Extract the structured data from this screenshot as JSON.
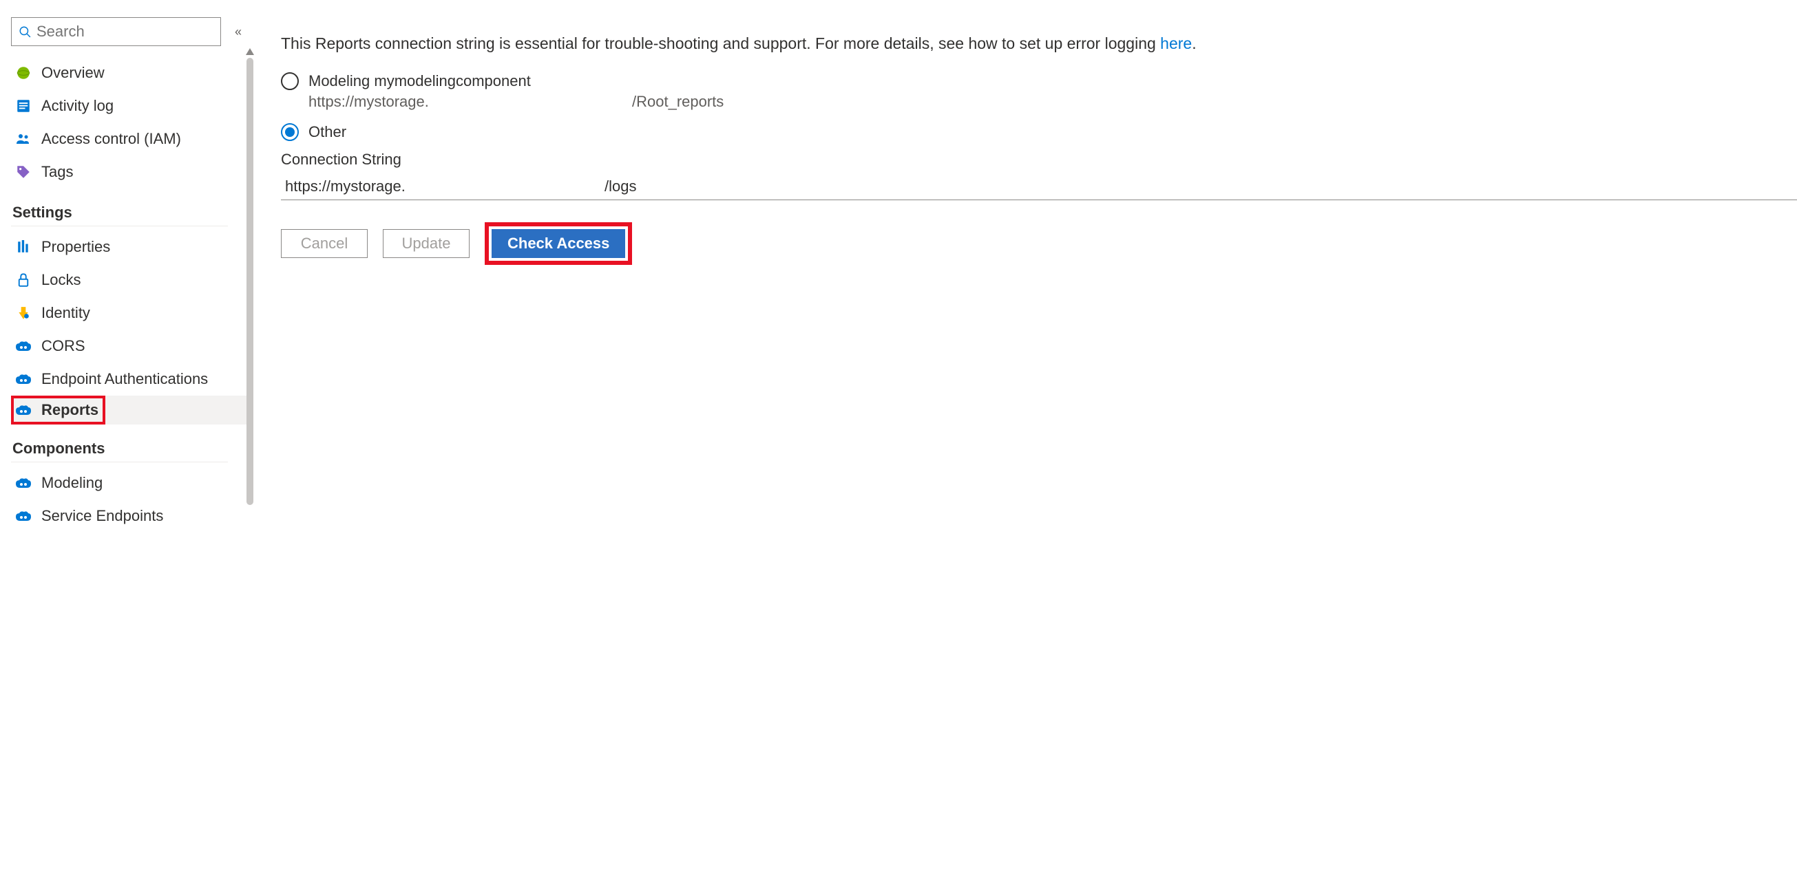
{
  "sidebar": {
    "search_placeholder": "Search",
    "items": [
      {
        "icon": "overview",
        "label": "Overview"
      },
      {
        "icon": "activitylog",
        "label": "Activity log"
      },
      {
        "icon": "iam",
        "label": "Access control (IAM)"
      },
      {
        "icon": "tags",
        "label": "Tags"
      }
    ],
    "settings_header": "Settings",
    "settings_items": [
      {
        "icon": "properties",
        "label": "Properties"
      },
      {
        "icon": "locks",
        "label": "Locks"
      },
      {
        "icon": "identity",
        "label": "Identity"
      },
      {
        "icon": "cors",
        "label": "CORS"
      },
      {
        "icon": "endpoint-auth",
        "label": "Endpoint Authentications"
      },
      {
        "icon": "reports",
        "label": "Reports",
        "selected": true
      }
    ],
    "components_header": "Components",
    "components_items": [
      {
        "icon": "modeling",
        "label": "Modeling"
      },
      {
        "icon": "service-endpoints",
        "label": "Service Endpoints"
      }
    ]
  },
  "main": {
    "intro_text": "This Reports connection string is essential for trouble-shooting and support. For more details, see how to set up error logging ",
    "intro_link": "here",
    "intro_suffix": ".",
    "radio1_label": "Modeling mymodelingcomponent",
    "radio1_sub_a": "https://mystorage.",
    "radio1_sub_b": "/Root_reports",
    "radio2_label": "Other",
    "conn_label": "Connection String",
    "conn_value_a": "https://mystorage.",
    "conn_value_b": "/logs",
    "cancel": "Cancel",
    "update": "Update",
    "check_access": "Check Access"
  }
}
